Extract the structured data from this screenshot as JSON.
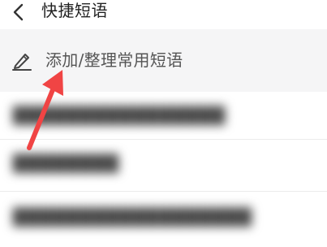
{
  "header": {
    "title": "快捷短语",
    "back_icon": "chevron-left-icon"
  },
  "add_row": {
    "label": "添加/整理常用短语",
    "icon": "pencil-edit-icon"
  },
  "phrases": [
    {
      "text": "████████████████"
    },
    {
      "text": "████████"
    },
    {
      "text": "██████████████████"
    }
  ],
  "annotation": {
    "arrow_color": "#f04444"
  }
}
